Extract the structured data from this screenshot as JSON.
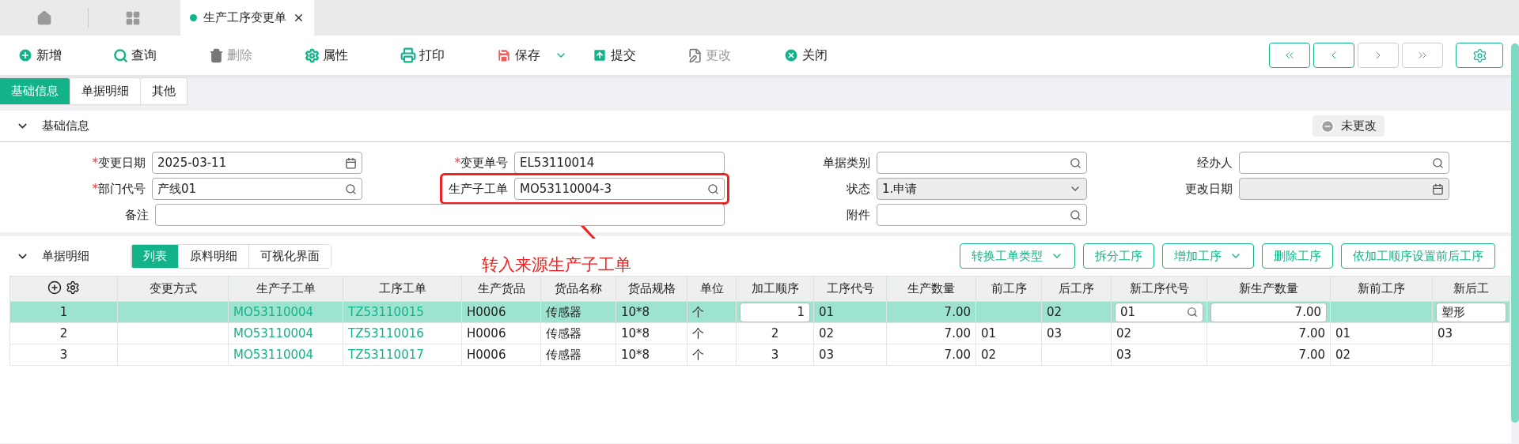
{
  "open_tabs": [
    {
      "title": "生产工序变更单",
      "selected": true
    }
  ],
  "toolbar": [
    {
      "kind": "add",
      "label": "新增",
      "disabled": false
    },
    {
      "kind": "query",
      "label": "查询",
      "disabled": false
    },
    {
      "kind": "delete",
      "label": "删除",
      "disabled": true
    },
    {
      "kind": "props",
      "label": "属性",
      "disabled": false
    },
    {
      "kind": "print",
      "label": "打印",
      "disabled": false
    },
    {
      "kind": "save",
      "label": "保存",
      "disabled": false,
      "dropdown": true
    },
    {
      "kind": "submit",
      "label": "提交",
      "disabled": false
    },
    {
      "kind": "edit",
      "label": "更改",
      "disabled": true
    },
    {
      "kind": "close",
      "label": "关闭",
      "disabled": false
    }
  ],
  "nav_buttons": [
    {
      "kind": "first",
      "disabled": false
    },
    {
      "kind": "prev",
      "disabled": false
    },
    {
      "kind": "next",
      "disabled": true
    },
    {
      "kind": "last",
      "disabled": true
    }
  ],
  "section_tabs": [
    {
      "label": "基础信息",
      "selected": true
    },
    {
      "label": "单据明细",
      "selected": false
    },
    {
      "label": "其他",
      "selected": false
    }
  ],
  "basic_info": {
    "title": "基础信息",
    "expanded": true,
    "status_badge": "未更改",
    "fields": [
      {
        "label": "变更日期",
        "required_mark": "*",
        "kind": "date",
        "value": "2025-03-11"
      },
      {
        "label": "变更单号",
        "required_mark": "*",
        "kind": "text",
        "value": "EL53110014"
      },
      {
        "label": "单据类别",
        "kind": "search"
      },
      {
        "label": "经办人",
        "kind": "search"
      },
      {
        "label": "部门代号",
        "required_mark": "*",
        "kind": "search",
        "value": "产线01"
      },
      {
        "label": "生产子工单",
        "kind": "search",
        "value": "MO53110004-3",
        "highlighted": true
      },
      {
        "label": "状态",
        "kind": "select",
        "value": "1.申请"
      },
      {
        "label": "更改日期",
        "kind": "date",
        "disabled": true
      },
      {
        "label": "备注",
        "kind": "text",
        "wide": true
      },
      {
        "label": "附件",
        "kind": "search"
      }
    ]
  },
  "annotation": "转入来源生产子工单",
  "detail": {
    "title": "单据明细",
    "expanded": true,
    "view_tabs": [
      {
        "label": "列表",
        "selected": true
      },
      {
        "label": "原料明细",
        "selected": false
      },
      {
        "label": "可视化界面",
        "selected": false
      }
    ],
    "actions": [
      {
        "label": "转换工单类型",
        "dropdown": true
      },
      {
        "label": "拆分工序",
        "dropdown": false
      },
      {
        "label": "增加工序",
        "dropdown": true
      },
      {
        "label": "删除工序",
        "dropdown": false
      },
      {
        "label": "依加工顺序设置前后工序",
        "dropdown": false
      }
    ]
  },
  "table": {
    "columns": [
      "变更方式",
      "生产子工单",
      "工序工单",
      "生产货品",
      "货品名称",
      "货品规格",
      "单位",
      "加工顺序",
      "工序代号",
      "生产数量",
      "前工序",
      "后工序",
      "新工序代号",
      "新生产数量",
      "新前工序",
      "新后工"
    ],
    "rows": [
      {
        "selected": true,
        "index": "1",
        "cells": [
          {
            "kind": "empty"
          },
          {
            "kind": "link",
            "text": "MO53110004"
          },
          {
            "kind": "link",
            "text": "TZ53110015"
          },
          {
            "kind": "text",
            "text": "H0006"
          },
          {
            "kind": "text",
            "text": "传感器"
          },
          {
            "kind": "text",
            "text": "10*8"
          },
          {
            "kind": "text",
            "text": "个"
          },
          {
            "kind": "number-input",
            "text": "1"
          },
          {
            "kind": "text",
            "text": "01"
          },
          {
            "kind": "number",
            "text": "7.00"
          },
          {
            "kind": "empty"
          },
          {
            "kind": "text",
            "text": "02"
          },
          {
            "kind": "search-input",
            "text": "01"
          },
          {
            "kind": "number-input",
            "text": "7.00"
          },
          {
            "kind": "empty"
          },
          {
            "kind": "input",
            "text": "塑形"
          }
        ]
      },
      {
        "selected": false,
        "index": "2",
        "cells": [
          {
            "kind": "empty"
          },
          {
            "kind": "link",
            "text": "MO53110004"
          },
          {
            "kind": "link",
            "text": "TZ53110016"
          },
          {
            "kind": "text",
            "text": "H0006"
          },
          {
            "kind": "text",
            "text": "传感器"
          },
          {
            "kind": "text",
            "text": "10*8"
          },
          {
            "kind": "text",
            "text": "个"
          },
          {
            "kind": "index",
            "text": "2"
          },
          {
            "kind": "text",
            "text": "02"
          },
          {
            "kind": "number",
            "text": "7.00"
          },
          {
            "kind": "text",
            "text": "01"
          },
          {
            "kind": "text",
            "text": "03"
          },
          {
            "kind": "text",
            "text": "02"
          },
          {
            "kind": "number",
            "text": "7.00"
          },
          {
            "kind": "text",
            "text": "01"
          },
          {
            "kind": "text",
            "text": "03"
          }
        ]
      },
      {
        "selected": false,
        "index": "3",
        "cells": [
          {
            "kind": "empty"
          },
          {
            "kind": "link",
            "text": "MO53110004"
          },
          {
            "kind": "link",
            "text": "TZ53110017"
          },
          {
            "kind": "text",
            "text": "H0006"
          },
          {
            "kind": "text",
            "text": "传感器"
          },
          {
            "kind": "text",
            "text": "10*8"
          },
          {
            "kind": "text",
            "text": "个"
          },
          {
            "kind": "index",
            "text": "3"
          },
          {
            "kind": "text",
            "text": "03"
          },
          {
            "kind": "number",
            "text": "7.00"
          },
          {
            "kind": "text",
            "text": "02"
          },
          {
            "kind": "empty"
          },
          {
            "kind": "text",
            "text": "03"
          },
          {
            "kind": "number",
            "text": "7.00"
          },
          {
            "kind": "text",
            "text": "02"
          },
          {
            "kind": "empty"
          }
        ]
      }
    ]
  }
}
